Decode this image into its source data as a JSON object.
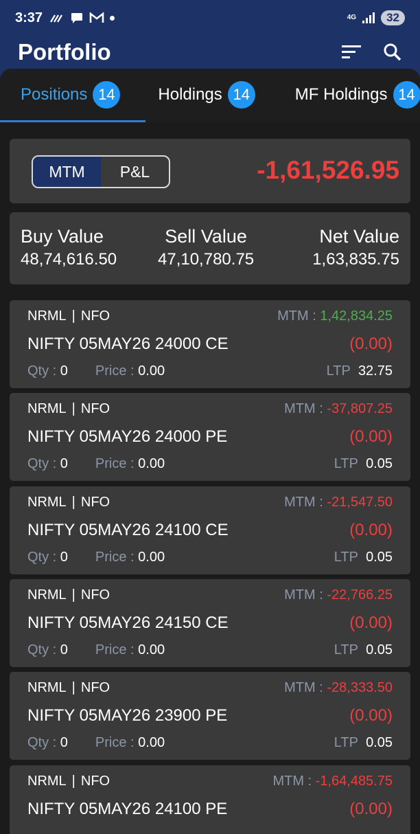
{
  "status_bar": {
    "time": "3:37",
    "battery": "32",
    "network": "4G"
  },
  "header": {
    "title": "Portfolio"
  },
  "tabs": [
    {
      "label": "Positions",
      "count": "14"
    },
    {
      "label": "Holdings",
      "count": "14"
    },
    {
      "label": "MF Holdings",
      "count": "14"
    }
  ],
  "summary": {
    "toggle": {
      "mtm_label": "MTM",
      "pnl_label": "P&L",
      "selected": "MTM"
    },
    "total_mtm": "-1,61,526.95",
    "buy_value_label": "Buy Value",
    "buy_value": "48,74,616.50",
    "sell_value_label": "Sell Value",
    "sell_value": "47,10,780.75",
    "net_value_label": "Net Value",
    "net_value": "1,63,835.75"
  },
  "labels": {
    "mtm": "MTM :",
    "qty": "Qty :",
    "price": "Price :",
    "ltp": "LTP",
    "separator": "|"
  },
  "positions": [
    {
      "product": "NRML",
      "exchange": "NFO",
      "mtm": "1,42,834.25",
      "symbol": "NIFTY 05MAY26 24000 CE",
      "change": "(0.00)",
      "qty": "0",
      "price": "0.00",
      "ltp": "32.75"
    },
    {
      "product": "NRML",
      "exchange": "NFO",
      "mtm": "-37,807.25",
      "symbol": "NIFTY 05MAY26 24000 PE",
      "change": "(0.00)",
      "qty": "0",
      "price": "0.00",
      "ltp": "0.05"
    },
    {
      "product": "NRML",
      "exchange": "NFO",
      "mtm": "-21,547.50",
      "symbol": "NIFTY 05MAY26 24100 CE",
      "change": "(0.00)",
      "qty": "0",
      "price": "0.00",
      "ltp": "0.05"
    },
    {
      "product": "NRML",
      "exchange": "NFO",
      "mtm": "-22,766.25",
      "symbol": "NIFTY 05MAY26 24150 CE",
      "change": "(0.00)",
      "qty": "0",
      "price": "0.00",
      "ltp": "0.05"
    },
    {
      "product": "NRML",
      "exchange": "NFO",
      "mtm": "-28,333.50",
      "symbol": "NIFTY 05MAY26 23900 PE",
      "change": "(0.00)",
      "qty": "0",
      "price": "0.00",
      "ltp": "0.05"
    },
    {
      "product": "NRML",
      "exchange": "NFO",
      "mtm": "-1,64,485.75",
      "symbol": "NIFTY 05MAY26 24100 PE",
      "change": "(0.00)",
      "qty": "",
      "price": "",
      "ltp": ""
    }
  ],
  "colors": {
    "header_bg": "#1d3367",
    "card_bg": "#3a3a3a",
    "profit": "#4caf50",
    "loss": "#ef3e3e",
    "accent": "#2196f3"
  }
}
